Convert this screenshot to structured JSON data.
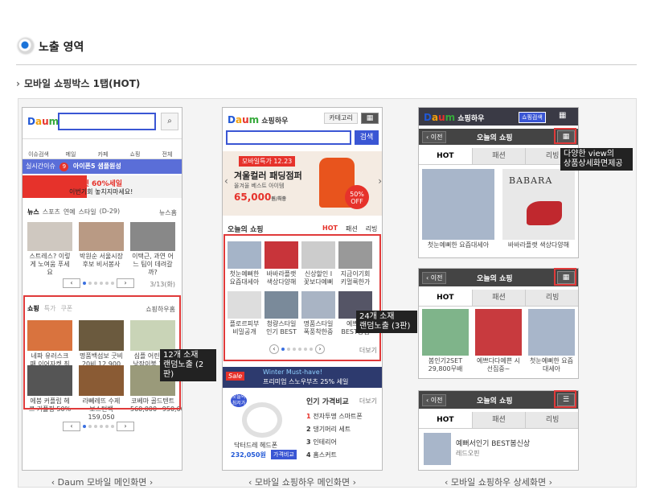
{
  "header": {
    "title": "노출 영역",
    "subtitle": "모바일 쇼핑박스 1탭(HOT)"
  },
  "phone1": {
    "caption": "Daum 모바일 메인화면",
    "logo": {
      "d": "D",
      "a": "a",
      "u": "u",
      "m": "m"
    },
    "search_icon": "search-icon",
    "nav": [
      "이슈검색",
      "메일",
      "카페",
      "쇼핑",
      "전체"
    ],
    "rt": {
      "label": "실시간이슈",
      "rank": "9",
      "text": "아이폰5 샘플원성"
    },
    "banner": {
      "line1": "지마켓 60%세일",
      "line2": "이번기회 놓치지마세요!"
    },
    "news_tabs": [
      "뉴스",
      "스포츠",
      "연예",
      "스타일"
    ],
    "news_extra": "(D-29)",
    "news_more": "뉴스홈",
    "news_items": [
      "스트레스? 이렇게 노여움 푸세요",
      "박원순 서울시장 후보 비서봉사",
      "이택근, 과연 어느 팀이 데려갈까?"
    ],
    "news_page": "3/13(화)",
    "shop_tabs": [
      "쇼핑",
      "특가",
      "쿠폰"
    ],
    "shop_more": "쇼핑하우홈",
    "shop_items": [
      "네파 유러스크 패 이어자켓 최저가",
      "명품백섬보 굿비 20비 12,900",
      "심플 어린이집 낮잠이불 18만원"
    ],
    "shop_items2": [
      "에붕 커플립 헤르 커플핑 50%",
      "라뻬레뜨 수제 보스턴백 159,050",
      "코베마 골드텐트 560,000~950,000"
    ],
    "tip": "12개 소재\n랜덤노출 (2판)"
  },
  "phone2": {
    "caption": "모바일 쇼핑하우 메인화면",
    "logo_suffix": "쇼핑하우",
    "category_btn": "카테고리",
    "search_btn": "검색",
    "promo": {
      "badge": "모바일특가 12.23",
      "title": "겨울컬러 패딩점퍼",
      "sub": "올겨울 베스트 아이템",
      "price": "65,000",
      "price_unit": "원/최종",
      "sale": "50%",
      "sale_unit": "OFF"
    },
    "today": {
      "title": "오늘의 쇼핑",
      "tabs": [
        "HOT",
        "패션",
        "리빙"
      ]
    },
    "grid_row1": [
      "첫눈예뻐한 요즘대세아",
      "바바라플랫 색상다양해",
      "신상할인 I 꽃보다예뻐",
      "지금이기회 키멀룩한가"
    ],
    "grid_row2": [
      "플로르피부 비밀공개",
      "청량스타일 인기 BEST",
      "명품스타일 폭풍착한중",
      "예쁘다 BEST중심"
    ],
    "grid_more": "더보기",
    "tip": "24개 소재\n랜덤노출 (3판)",
    "sale_banner": {
      "badge": "Sale",
      "line1": "Winter Must-have!",
      "line2": "프리미엄 스노우부츠 25% 세일"
    },
    "rank": {
      "title": "인기 가격비교",
      "more": "더보기",
      "items": [
        "전자투명 스마트폰",
        "댕기머리 세트",
        "인테리어",
        "홈스커트"
      ]
    },
    "deal": {
      "badge": "오늘의 최저가",
      "name": "닥터드레 헤드폰",
      "price": "232,050원",
      "btn": "가격비교"
    }
  },
  "phone3": {
    "caption": "모바일 쇼핑하우 상세화면",
    "logo_suffix": "쇼핑하우",
    "search_label": "쇼핑검색",
    "prev": "이전",
    "title": "오늘의 쇼핑",
    "tabs": [
      "HOT",
      "패션",
      "리빙"
    ],
    "view1": [
      "첫눈예뻐한 요즘대세아",
      "바바라플랫 색상다양해"
    ],
    "view1_brand": "BABARA",
    "view2": [
      "봄인기2SET 29,800무배",
      "예쁘다다예쁜 시선집중~",
      "첫눈예뻐한 요즘대세아"
    ],
    "view3": {
      "title": "예뻐서인기 BEST봄신상",
      "sub": "레드오핀"
    },
    "tip": "다양한 view의\n상품상세화면제공"
  },
  "colors": {
    "accent": "#e03a3a",
    "brand": "#2158d6",
    "dark": "#3a3a45"
  }
}
